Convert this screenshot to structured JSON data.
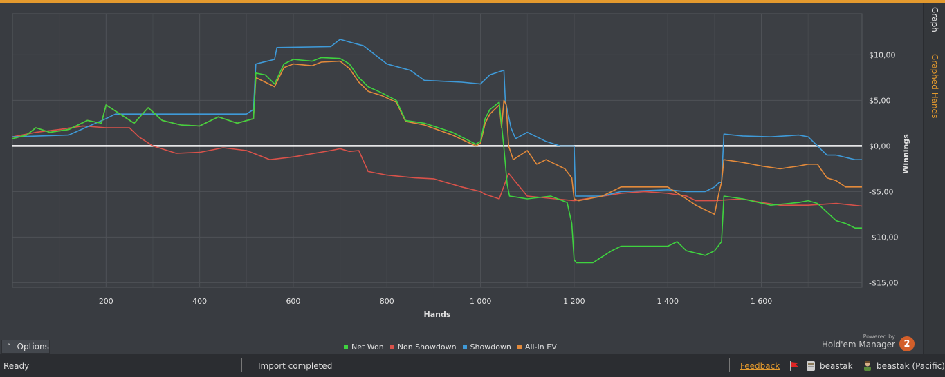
{
  "right_tabs": {
    "graph": "Graph",
    "graphed_hands": "Graphed Hands"
  },
  "options": {
    "label": "Options"
  },
  "brand": {
    "powered_by": "Powered by",
    "name": "Hold'em Manager",
    "logo_text": "2"
  },
  "status": {
    "ready": "Ready",
    "import": "Import completed",
    "feedback": "Feedback",
    "user": "beastak",
    "user_site": "beastak (Pacific)"
  },
  "colors": {
    "accent": "#e49a2e",
    "net_won": "#3fd23f",
    "non_showdown": "#d9524a",
    "showdown": "#3f9ad8",
    "all_in_ev": "#e38a3b",
    "zero_line": "#ffffff"
  },
  "chart_data": {
    "type": "line",
    "xlabel": "Hands",
    "ylabel": "Winnings",
    "xlim": [
      0,
      1815
    ],
    "ylim": [
      -15.5,
      14.5
    ],
    "x_ticks": [
      200,
      400,
      600,
      800,
      1000,
      1200,
      1400,
      1600
    ],
    "x_tick_labels": [
      "200",
      "400",
      "600",
      "800",
      "1 000",
      "1 200",
      "1 400",
      "1 600"
    ],
    "y_ticks": [
      10,
      5,
      0,
      -5,
      -10,
      -15
    ],
    "y_tick_labels": [
      "$10,00",
      "$5,00",
      "$0,00",
      "-$5,00",
      "-$10,00",
      "-$15,00"
    ],
    "grid": true,
    "legend_position": "bottom-center",
    "series": [
      {
        "name": "Net Won",
        "color": "#3fd23f",
        "x": [
          0,
          30,
          50,
          80,
          120,
          160,
          190,
          200,
          230,
          260,
          290,
          320,
          360,
          400,
          440,
          480,
          515,
          520,
          540,
          560,
          580,
          600,
          640,
          660,
          700,
          720,
          740,
          760,
          790,
          820,
          840,
          880,
          940,
          990,
          1000,
          1010,
          1020,
          1040,
          1050,
          1057,
          1062,
          1075,
          1100,
          1150,
          1185,
          1195,
          1200,
          1205,
          1240,
          1280,
          1300,
          1400,
          1420,
          1440,
          1480,
          1500,
          1515,
          1520,
          1560,
          1620,
          1680,
          1700,
          1720,
          1760,
          1780,
          1800,
          1815
        ],
        "y": [
          0.8,
          1.2,
          2.0,
          1.5,
          1.8,
          2.8,
          2.5,
          4.5,
          3.5,
          2.5,
          4.2,
          2.8,
          2.3,
          2.2,
          3.2,
          2.5,
          3.0,
          8.0,
          7.8,
          6.8,
          9.0,
          9.5,
          9.3,
          9.7,
          9.6,
          9.0,
          7.5,
          6.5,
          5.8,
          5.0,
          2.8,
          2.5,
          1.5,
          0.2,
          0.5,
          3.0,
          4.0,
          4.8,
          -0.2,
          -4.2,
          -5.5,
          -5.6,
          -5.8,
          -5.5,
          -6.2,
          -8.5,
          -12.5,
          -12.8,
          -12.8,
          -11.5,
          -11.0,
          -11.0,
          -10.5,
          -11.5,
          -12.0,
          -11.5,
          -10.5,
          -5.5,
          -5.8,
          -6.5,
          -6.2,
          -6.0,
          -6.3,
          -8.2,
          -8.5,
          -9.0,
          -9.0
        ]
      },
      {
        "name": "Non Showdown",
        "color": "#d9524a",
        "x": [
          0,
          50,
          100,
          150,
          200,
          250,
          270,
          300,
          350,
          400,
          450,
          500,
          550,
          600,
          680,
          700,
          720,
          740,
          760,
          800,
          860,
          900,
          960,
          1000,
          1010,
          1040,
          1060,
          1100,
          1160,
          1200,
          1300,
          1350,
          1400,
          1440,
          1460,
          1500,
          1560,
          1600,
          1640,
          1700,
          1760,
          1815
        ],
        "y": [
          1.0,
          1.5,
          1.8,
          2.2,
          2.0,
          2.0,
          1.0,
          0.0,
          -0.8,
          -0.7,
          -0.2,
          -0.5,
          -1.5,
          -1.2,
          -0.5,
          -0.3,
          -0.6,
          -0.5,
          -2.8,
          -3.2,
          -3.5,
          -3.6,
          -4.5,
          -5.0,
          -5.3,
          -5.8,
          -3.0,
          -5.5,
          -5.8,
          -6.0,
          -5.2,
          -5.0,
          -5.2,
          -5.5,
          -6.0,
          -6.0,
          -5.8,
          -6.2,
          -6.5,
          -6.5,
          -6.3,
          -6.6
        ]
      },
      {
        "name": "Showdown",
        "color": "#3f9ad8",
        "x": [
          0,
          120,
          200,
          220,
          260,
          500,
          515,
          520,
          560,
          565,
          680,
          700,
          720,
          750,
          800,
          850,
          880,
          960,
          1000,
          1020,
          1050,
          1053,
          1065,
          1075,
          1100,
          1120,
          1140,
          1170,
          1200,
          1203,
          1260,
          1300,
          1400,
          1440,
          1480,
          1500,
          1510,
          1515,
          1520,
          1560,
          1620,
          1680,
          1700,
          1740,
          1760,
          1800,
          1815
        ],
        "y": [
          1.0,
          1.2,
          3.0,
          3.5,
          3.5,
          3.5,
          4.0,
          9.0,
          9.5,
          10.8,
          10.9,
          11.7,
          11.4,
          11.0,
          9.0,
          8.3,
          7.2,
          7.0,
          6.8,
          7.8,
          8.3,
          5.0,
          2.0,
          0.8,
          1.5,
          1.0,
          0.5,
          0.0,
          0.0,
          -5.5,
          -5.5,
          -5.0,
          -4.8,
          -5.0,
          -5.0,
          -4.5,
          -4.0,
          -4.0,
          1.3,
          1.1,
          1.0,
          1.2,
          1.0,
          -1.0,
          -1.0,
          -1.5,
          -1.5
        ]
      },
      {
        "name": "All-In EV",
        "color": "#e38a3b",
        "x": [
          0,
          30,
          50,
          80,
          120,
          160,
          190,
          200,
          230,
          260,
          290,
          320,
          360,
          400,
          440,
          480,
          515,
          520,
          540,
          560,
          580,
          600,
          640,
          660,
          700,
          720,
          740,
          760,
          790,
          820,
          840,
          880,
          940,
          990,
          1000,
          1010,
          1020,
          1040,
          1045,
          1050,
          1055,
          1060,
          1070,
          1100,
          1120,
          1140,
          1160,
          1180,
          1195,
          1200,
          1210,
          1260,
          1300,
          1400,
          1440,
          1460,
          1480,
          1500,
          1510,
          1515,
          1520,
          1560,
          1600,
          1640,
          1680,
          1700,
          1720,
          1740,
          1760,
          1780,
          1800,
          1815
        ],
        "y": [
          0.8,
          1.2,
          2.0,
          1.5,
          1.8,
          2.8,
          2.5,
          4.5,
          3.5,
          2.5,
          4.2,
          2.8,
          2.3,
          2.2,
          3.2,
          2.5,
          3.0,
          7.5,
          7.0,
          6.5,
          8.6,
          9.0,
          8.8,
          9.2,
          9.3,
          8.5,
          7.0,
          6.0,
          5.5,
          4.8,
          2.7,
          2.3,
          1.2,
          0.0,
          0.3,
          2.5,
          3.5,
          4.5,
          2.0,
          5.0,
          4.5,
          0.0,
          -1.5,
          -0.5,
          -2.0,
          -1.5,
          -2.0,
          -2.5,
          -3.5,
          -5.8,
          -6.0,
          -5.5,
          -4.5,
          -4.5,
          -5.8,
          -6.5,
          -7.0,
          -7.5,
          -5.0,
          -4.0,
          -1.5,
          -1.8,
          -2.2,
          -2.5,
          -2.2,
          -2.0,
          -2.0,
          -3.5,
          -3.8,
          -4.5,
          -4.5,
          -4.5
        ]
      }
    ]
  }
}
